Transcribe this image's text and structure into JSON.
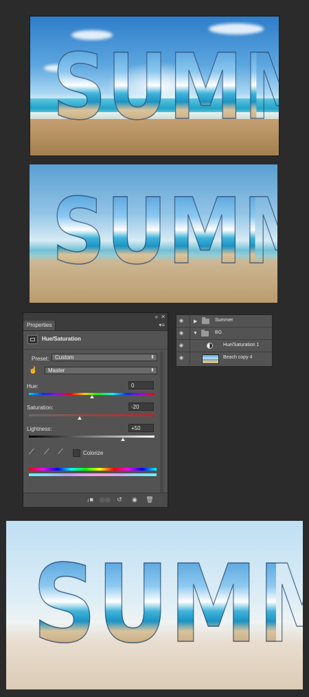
{
  "images": {
    "image1_text": "SUMMER",
    "image2_text": "SUMMER",
    "image3_text": "SUMMER"
  },
  "properties_panel": {
    "window_controls": {
      "collapse": "«",
      "close": "✕"
    },
    "tab_label": "Properties",
    "menu_icon": "panel-menu-icon",
    "header_title": "Hue/Saturation",
    "preset_label": "Preset:",
    "preset_value": "Custom",
    "channel_value": "Master",
    "hue_label": "Hue:",
    "hue_value": "0",
    "saturation_label": "Saturation:",
    "saturation_value": "-20",
    "lightness_label": "Lightness:",
    "lightness_value": "+50",
    "colorize_label": "Colorize",
    "colorize_checked": false,
    "footer_icons": [
      "clip-to-layer-icon",
      "view-previous-icon",
      "reset-icon",
      "visibility-icon",
      "delete-icon"
    ]
  },
  "layers_panel": {
    "layers": [
      {
        "name": "Summer",
        "type": "group",
        "expanded": false
      },
      {
        "name": "BG",
        "type": "group",
        "expanded": true
      },
      {
        "name": "Hue/Saturation 1",
        "type": "adjustment"
      },
      {
        "name": "Beach copy 4",
        "type": "image"
      }
    ]
  },
  "colors": {
    "background": "#2b2b2b",
    "panel": "#535353",
    "panel_dark": "#3c3c3c",
    "text": "#e0e0e0"
  }
}
